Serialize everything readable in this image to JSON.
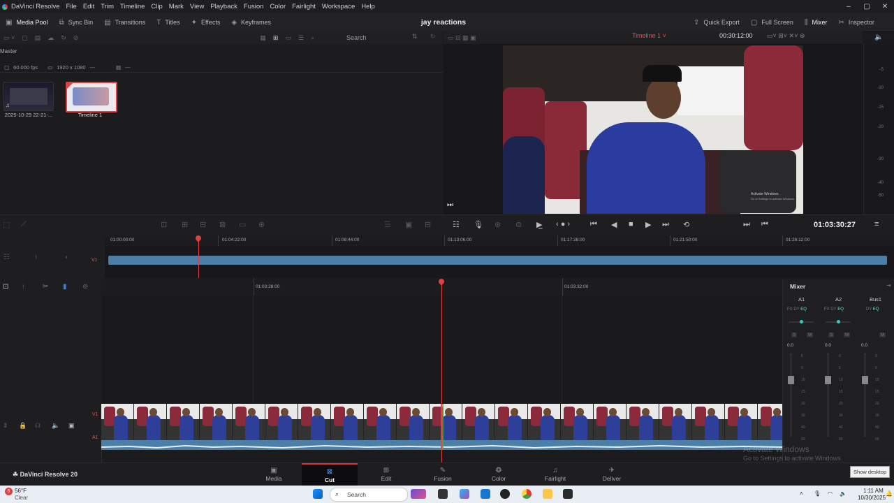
{
  "app": {
    "name": "DaVinci Resolve",
    "project_title": "jay reactions",
    "menu": [
      "File",
      "Edit",
      "Trim",
      "Timeline",
      "Clip",
      "Mark",
      "View",
      "Playback",
      "Fusion",
      "Color",
      "Fairlight",
      "Workspace",
      "Help"
    ],
    "window_controls": [
      "–",
      "▢",
      "✕"
    ]
  },
  "toolbar": {
    "left": [
      {
        "icon": "media-pool-icon",
        "label": "Media Pool"
      },
      {
        "icon": "sync-bin-icon",
        "label": "Sync Bin"
      },
      {
        "icon": "transitions-icon",
        "label": "Transitions"
      },
      {
        "icon": "titles-icon",
        "label": "Titles"
      },
      {
        "icon": "effects-icon",
        "label": "Effects"
      },
      {
        "icon": "keyframes-icon",
        "label": "Keyframes"
      }
    ],
    "right": [
      {
        "icon": "quick-export-icon",
        "label": "Quick Export"
      },
      {
        "icon": "full-screen-icon",
        "label": "Full Screen"
      },
      {
        "icon": "mixer-icon",
        "label": "Mixer"
      },
      {
        "icon": "inspector-icon",
        "label": "Inspector"
      }
    ]
  },
  "media_pool": {
    "search_placeholder": "Search",
    "breadcrumb": "Master",
    "fps": "60.000 fps",
    "resolution": "1920 x 1080",
    "dash1": "---",
    "dash2": "---",
    "clips": [
      {
        "name": "2025-10-29 22-21-..."
      },
      {
        "name": "Timeline 1"
      }
    ]
  },
  "viewer": {
    "timeline_name": "Timeline 1 ˅",
    "duration_tc": "00:30:12:00",
    "current_tc": "01:03:30:27",
    "meter_ticks": [
      "-5",
      "-10",
      "-15",
      "-20",
      "-30",
      "-40",
      "-50"
    ],
    "frame_watermark_1": "Activate Windows",
    "frame_watermark_2": "Go to Settings to activate Windows."
  },
  "timeline": {
    "upper_ruler": [
      "01:00:00:00",
      "01:04:22:00",
      "01:08:44:00",
      "01:13:06:00",
      "01:17:28:00",
      "01:21:50:00",
      "01:26:12:00"
    ],
    "lower_ruler": [
      "01:03:28:00",
      "01:03:32:00"
    ],
    "track_v1": "V1",
    "track_a1": "A1"
  },
  "mixer": {
    "title": "Mixer",
    "channels": [
      "A1",
      "A2",
      "Bus1"
    ],
    "fx_labels": [
      "FX",
      "DY",
      "EQ"
    ],
    "solo": "S",
    "mute": "M",
    "level": "0.0",
    "scale": [
      "0",
      "5",
      "10",
      "15",
      "20",
      "30",
      "40",
      "50"
    ]
  },
  "pages": [
    "Media",
    "Cut",
    "Edit",
    "Fusion",
    "Color",
    "Fairlight",
    "Deliver"
  ],
  "active_page": "Cut",
  "brand_footer": "DaVinci Resolve 20",
  "watermark": {
    "line1": "Activate Windows",
    "line2": "Go to Settings to activate Windows."
  },
  "show_desktop": "Show desktop",
  "taskbar": {
    "weather_temp": "56°F",
    "weather_cond": "Clear",
    "weather_badge": "6",
    "search": "Search",
    "time": "1:11 AM",
    "date": "10/30/2025"
  },
  "colors": {
    "accent": "#e04040",
    "clip": "#4b7fa8",
    "active_tab_border": "#e03030"
  }
}
